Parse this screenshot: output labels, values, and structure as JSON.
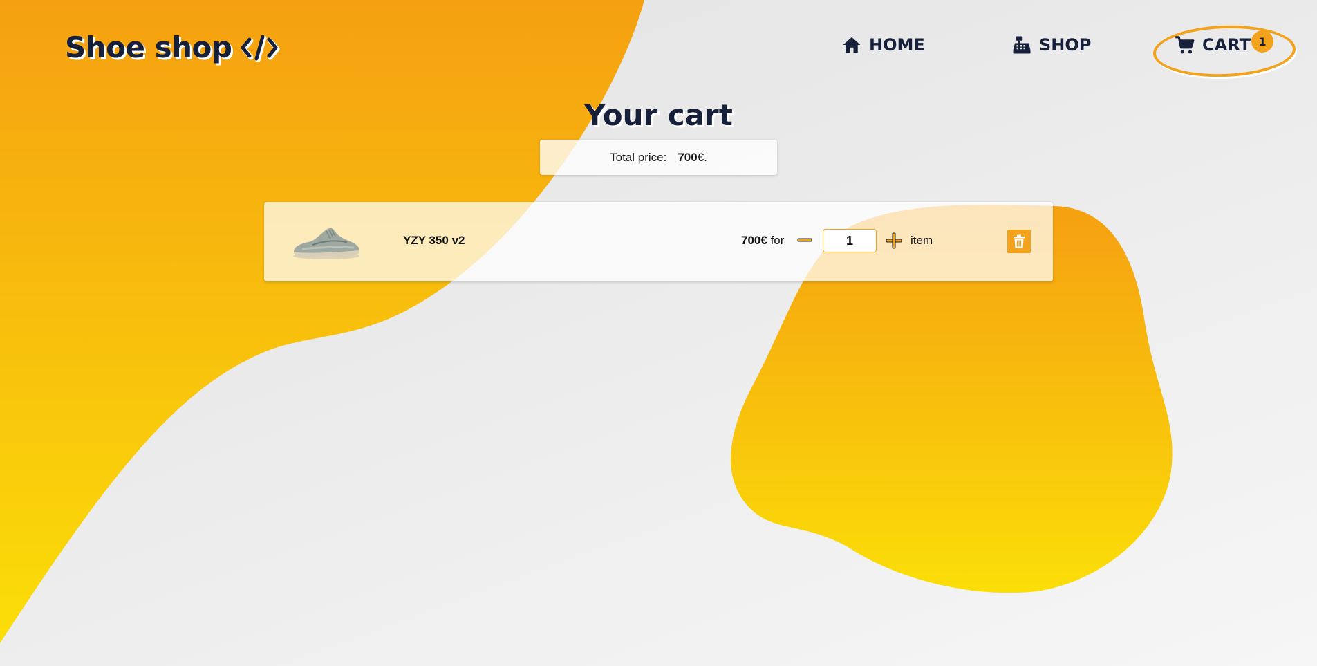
{
  "header": {
    "logo_text": "Shoe shop",
    "logo_icon": "code-icon",
    "nav": [
      {
        "label": "HOME",
        "icon": "home-icon"
      },
      {
        "label": "SHOP",
        "icon": "cash-register-icon"
      },
      {
        "label": "CART",
        "icon": "cart-icon"
      }
    ],
    "cart_count": "1"
  },
  "main": {
    "title": "Your cart",
    "total": {
      "label": "Total price:",
      "amount": "700",
      "currency": "€."
    }
  },
  "cart_items": [
    {
      "name": "YZY 350 v2",
      "price": "700€",
      "for_text": "for",
      "quantity": "1",
      "unit_label": "item",
      "image": "sneaker-image",
      "delete_icon": "trash-icon"
    }
  ],
  "colors": {
    "accent": "#f3a21c",
    "accent_light": "#f9d90a",
    "text_dark": "#16203a",
    "background": "#e4e4e4"
  }
}
